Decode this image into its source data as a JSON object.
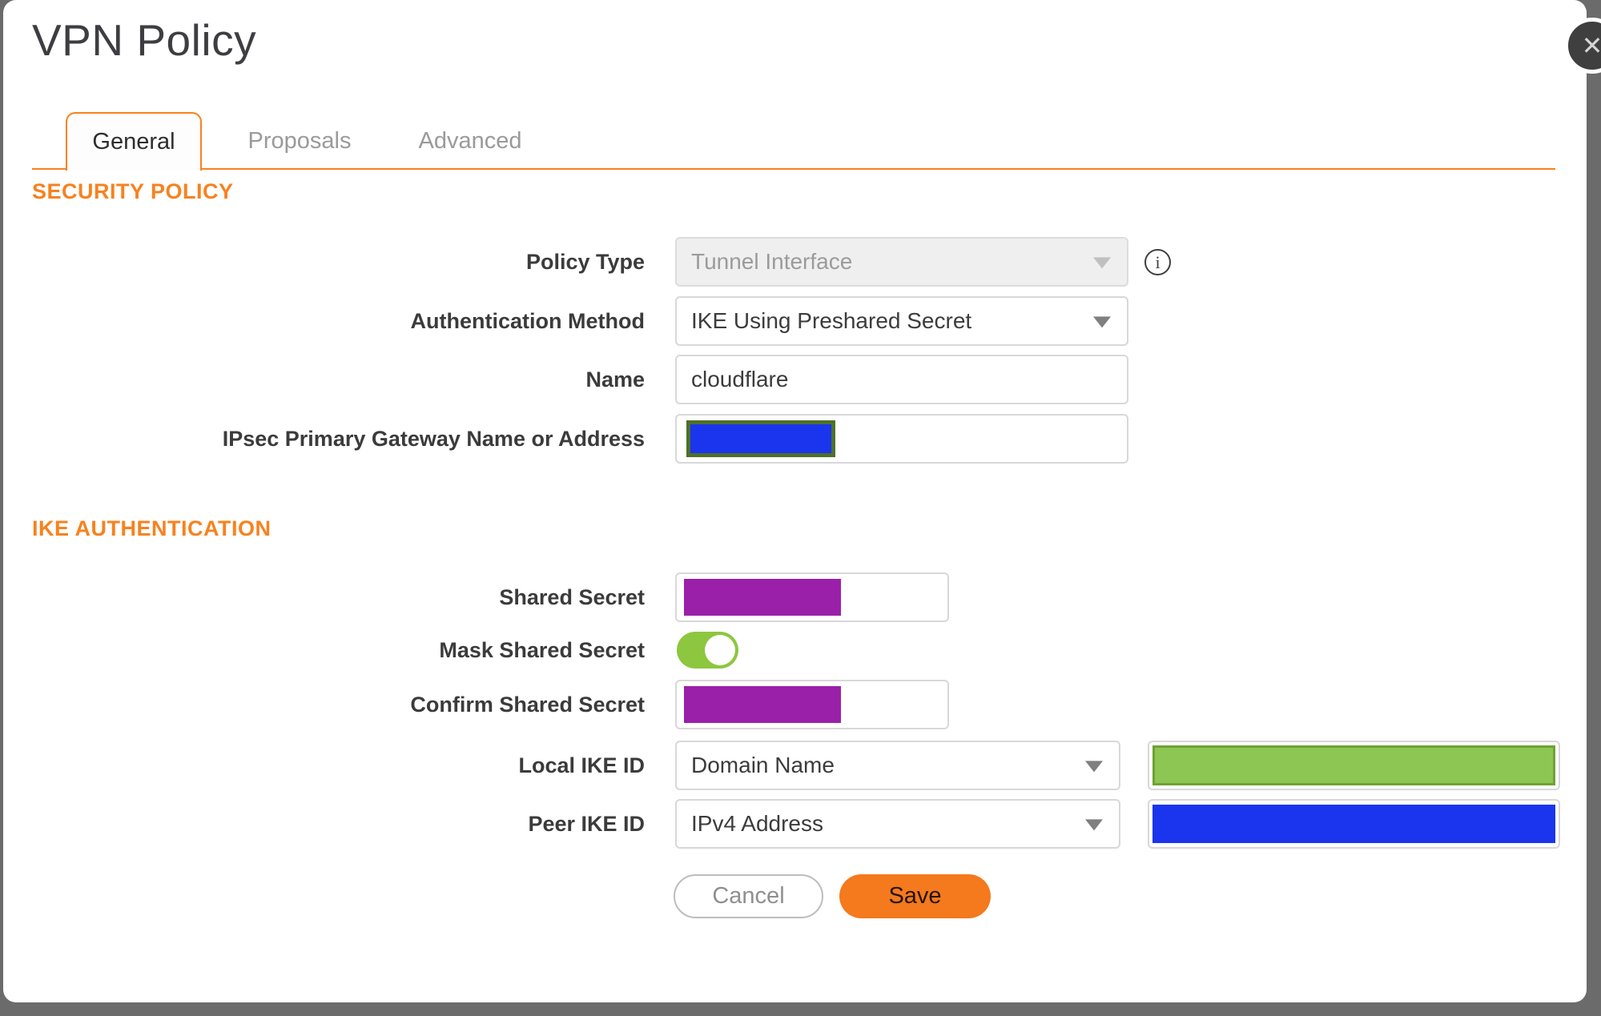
{
  "window": {
    "title": "VPN Policy",
    "close_icon": "✕"
  },
  "tabs": {
    "general": "General",
    "proposals": "Proposals",
    "advanced": "Advanced",
    "active_tab": "General"
  },
  "security_policy": {
    "heading": "SECURITY POLICY",
    "policy_type_label": "Policy Type",
    "policy_type_value": "Tunnel Interface",
    "policy_type_disabled": true,
    "info_icon": "i",
    "auth_method_label": "Authentication Method",
    "auth_method_value": "IKE Using Preshared Secret",
    "name_label": "Name",
    "name_value": "cloudflare",
    "gateway_label": "IPsec Primary Gateway Name or Address",
    "gateway_value_redacted": "blue-olive-block"
  },
  "ike_authentication": {
    "heading": "IKE AUTHENTICATION",
    "shared_secret_label": "Shared Secret",
    "shared_secret_redacted": "purple-block",
    "mask_shared_secret_label": "Mask Shared Secret",
    "mask_shared_secret_on": true,
    "confirm_shared_secret_label": "Confirm Shared Secret",
    "confirm_shared_secret_redacted": "purple-block",
    "local_ike_id_label": "Local IKE ID",
    "local_ike_id_type": "Domain Name",
    "local_ike_id_value_redacted": "green-block",
    "peer_ike_id_label": "Peer IKE ID",
    "peer_ike_id_type": "IPv4 Address",
    "peer_ike_id_value_redacted": "blue-block"
  },
  "footer": {
    "cancel": "Cancel",
    "save": "Save"
  },
  "colors": {
    "accent_orange": "#f7821f",
    "save_orange": "#f5791d",
    "toggle_green": "#8dc63f",
    "redact_purple": "#9b20a9",
    "redact_blue": "#1b35ee",
    "redact_green_fill": "#8dc652",
    "redact_green_border": "#6fa233",
    "redact_olive_border": "#4e7029",
    "backdrop_gray": "#6b6b6b"
  }
}
